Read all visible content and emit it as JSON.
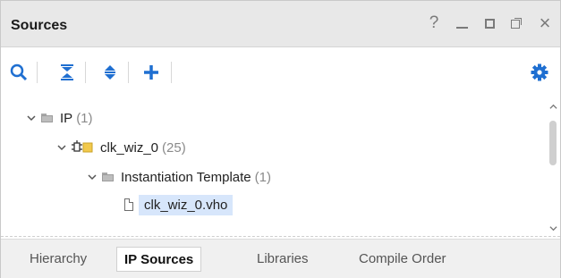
{
  "panel": {
    "title": "Sources",
    "controls": {
      "help": "?",
      "minimize": "minimize-icon",
      "maximize": "maximize-icon",
      "float": "float-icon",
      "close": "×"
    }
  },
  "toolbar": {
    "items": [
      {
        "icon": "search-icon"
      },
      {
        "icon": "collapse-all-icon"
      },
      {
        "icon": "expand-all-icon"
      },
      {
        "icon": "add-icon"
      },
      {
        "icon": "gear-icon"
      }
    ]
  },
  "tree": {
    "rows": [
      {
        "label": "IP",
        "count": "(1)",
        "icon": "folder-icon",
        "expanded": true
      },
      {
        "label": "clk_wiz_0",
        "count": "(25)",
        "icon": "ip-core-icon",
        "expanded": true
      },
      {
        "label": "Instantiation Template",
        "count": "(1)",
        "icon": "folder-icon",
        "expanded": true
      },
      {
        "label": "clk_wiz_0.vho",
        "count": "",
        "icon": "file-icon",
        "selected": true
      }
    ]
  },
  "tabs": [
    {
      "label": "Hierarchy",
      "active": false
    },
    {
      "label": "IP Sources",
      "active": true
    },
    {
      "label": "Libraries",
      "active": false
    },
    {
      "label": "Compile Order",
      "active": false
    }
  ],
  "colors": {
    "accent": "#1f6fd1",
    "selection": "#d7e6fb",
    "ip_icon_yellow": "#f2c94c"
  }
}
